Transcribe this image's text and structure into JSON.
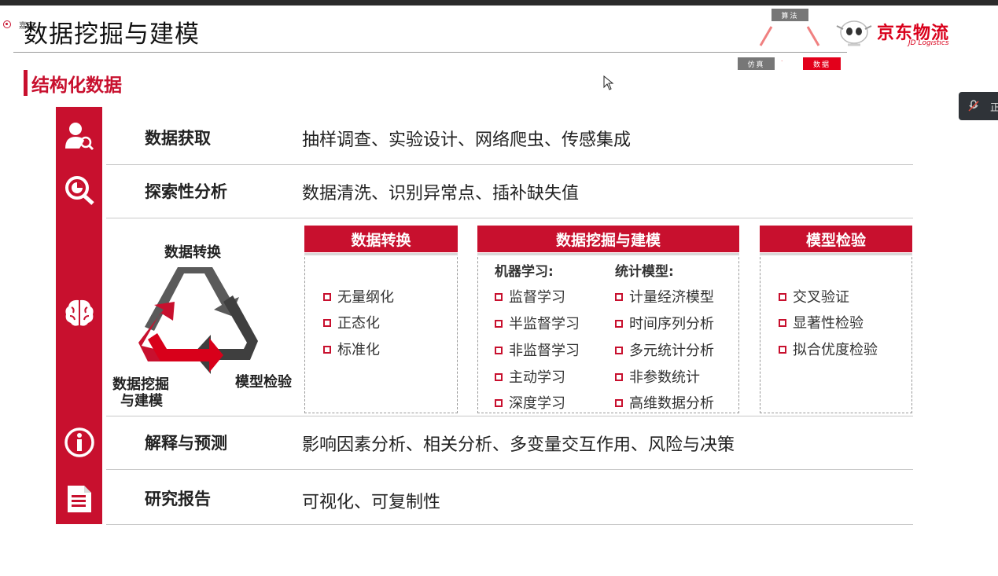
{
  "window": {
    "speaker_label": "嘉宾"
  },
  "slide": {
    "title": "数据挖掘与建模",
    "section_title": "结构化数据"
  },
  "logo": {
    "chip_algo": "算法",
    "chip_sim": "仿真",
    "chip_data": "数据",
    "brand_cn": "京东物流",
    "brand_en": "JD Logistics",
    "brand_color": "#d9001b"
  },
  "side_tab": {
    "text": "正"
  },
  "rows": [
    {
      "label": "数据获取",
      "text": "抽样调查、实验设计、网络爬虫、传感集成",
      "icon": "person-search-icon"
    },
    {
      "label": "探索性分析",
      "text": "数据清洗、识别异常点、插补缺失值",
      "icon": "magnifier-chart-icon"
    },
    {
      "label": "",
      "text": "",
      "icon": "brain-icon"
    },
    {
      "label": "解释与预测",
      "text": "影响因素分析、相关分析、多变量交互作用、风险与决策",
      "icon": "info-icon"
    },
    {
      "label": "研究报告",
      "text": "可视化、可复制性",
      "icon": "document-icon"
    }
  ],
  "cycle": {
    "top_label": "数据转换",
    "left_label_line1": "数据挖掘",
    "left_label_line2": "与建模",
    "right_label": "模型检验"
  },
  "boxes": {
    "transform": {
      "title": "数据转换",
      "items": [
        "无量纲化",
        "正态化",
        "标准化"
      ]
    },
    "mining": {
      "title": "数据挖掘与建模",
      "ml_head": "机器学习:",
      "ml_items": [
        "监督学习",
        "半监督学习",
        "非监督学习",
        "主动学习",
        "深度学习"
      ],
      "stat_head": "统计模型:",
      "stat_items": [
        "计量经济模型",
        "时间序列分析",
        "多元统计分析",
        "非参数统计",
        "高维数据分析"
      ]
    },
    "validate": {
      "title": "模型检验",
      "items": [
        "交叉验证",
        "显著性检验",
        "拟合优度检验"
      ]
    }
  },
  "colors": {
    "accent": "#c8102e",
    "dark_gray": "#4a4a4a"
  }
}
